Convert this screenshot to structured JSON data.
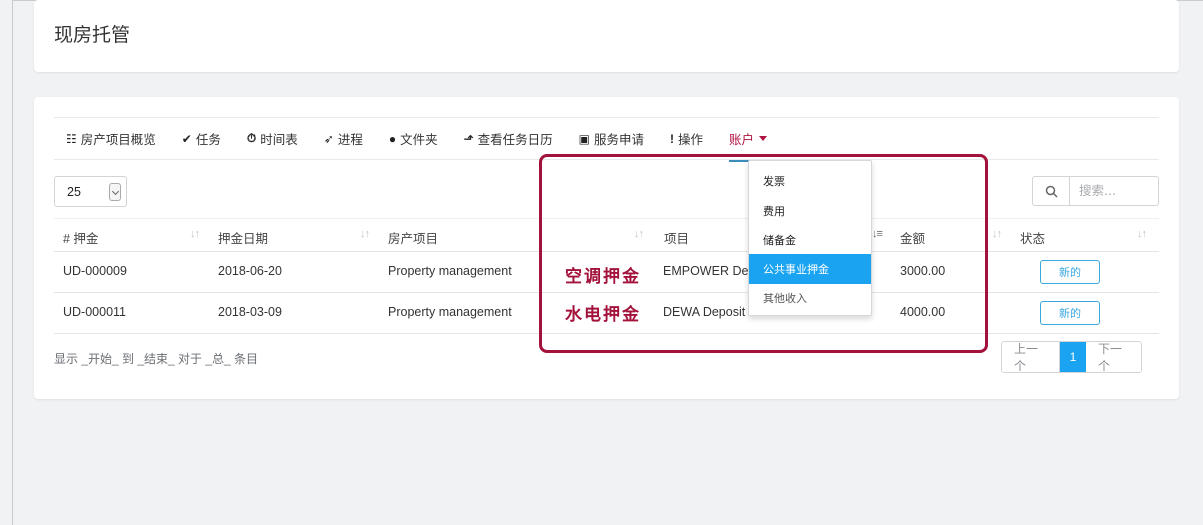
{
  "page": {
    "title": "现房托管"
  },
  "nav": {
    "items": [
      {
        "icon": "grid-icon",
        "glyph": "☷",
        "label": "房产项目概览"
      },
      {
        "icon": "check-circle-icon",
        "glyph": "✔",
        "label": "任务"
      },
      {
        "icon": "clock-icon",
        "glyph": "⏱",
        "label": "时间表"
      },
      {
        "icon": "rocket-icon",
        "glyph": "➶",
        "label": "进程"
      },
      {
        "icon": "comment-icon",
        "glyph": "●",
        "label": "文件夹"
      },
      {
        "icon": "line-chart-icon",
        "glyph": "⬏",
        "label": "查看任务日历"
      },
      {
        "icon": "id-card-icon",
        "glyph": "▣",
        "label": "服务申请"
      },
      {
        "icon": "exclamation-icon",
        "glyph": "!",
        "label": "操作"
      }
    ],
    "active": {
      "label": "账户"
    }
  },
  "controls": {
    "page_size": "25",
    "search_icon": "search-icon",
    "search_placeholder": "搜索..."
  },
  "table": {
    "headers": [
      "# 押金",
      "押金日期",
      "房产项目",
      "项目",
      "金额",
      "状态"
    ],
    "rows": [
      {
        "id": "UD-000009",
        "date": "2018-06-20",
        "project": "Property management",
        "item": "EMPOWER Dep",
        "amount": "3000.00",
        "status": "新的"
      },
      {
        "id": "UD-000011",
        "date": "2018-03-09",
        "project": "Property management",
        "item": "DEWA Deposit",
        "amount": "4000.00",
        "status": "新的"
      }
    ]
  },
  "annotations": [
    "空调押金",
    "水电押金"
  ],
  "info": "显示 _开始_ 到 _结束_ 对于 _总_ 条目",
  "pagination": {
    "prev": "上一个",
    "current": "1",
    "next": "下一个"
  },
  "dropdown": {
    "items": [
      "发票",
      "费用",
      "储备金",
      "公共事业押金",
      "其他收入"
    ],
    "highlighted": "公共事业押金"
  },
  "colors": {
    "accent": "#1aa3f0",
    "annotation": "#a3123a",
    "active_tab": "#b0123f"
  }
}
